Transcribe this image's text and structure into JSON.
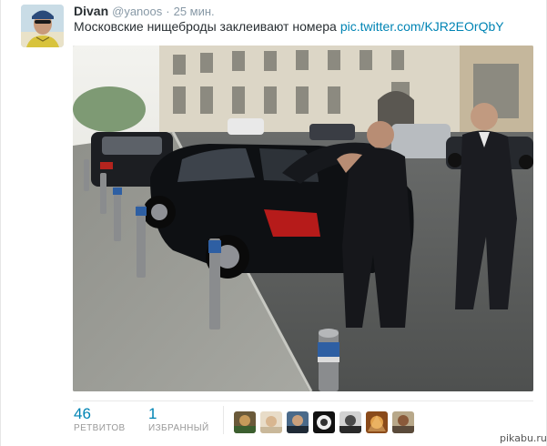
{
  "tweet": {
    "fullname": "Divan",
    "username": "@yanoos",
    "separator": "·",
    "time": "25 мин.",
    "text": "Московские нищеброды заклеивают номера",
    "link": "pic.twitter.com/KJR2EOrQbY"
  },
  "stats": {
    "retweets_count": "46",
    "retweets_label": "РЕТВИТОВ",
    "favorites_count": "1",
    "favorites_label": "ИЗБРАННЫЙ"
  },
  "watermark": "pikabu.ru",
  "colors": {
    "link": "#0084b4",
    "muted": "#8899a6",
    "text": "#292f33"
  }
}
